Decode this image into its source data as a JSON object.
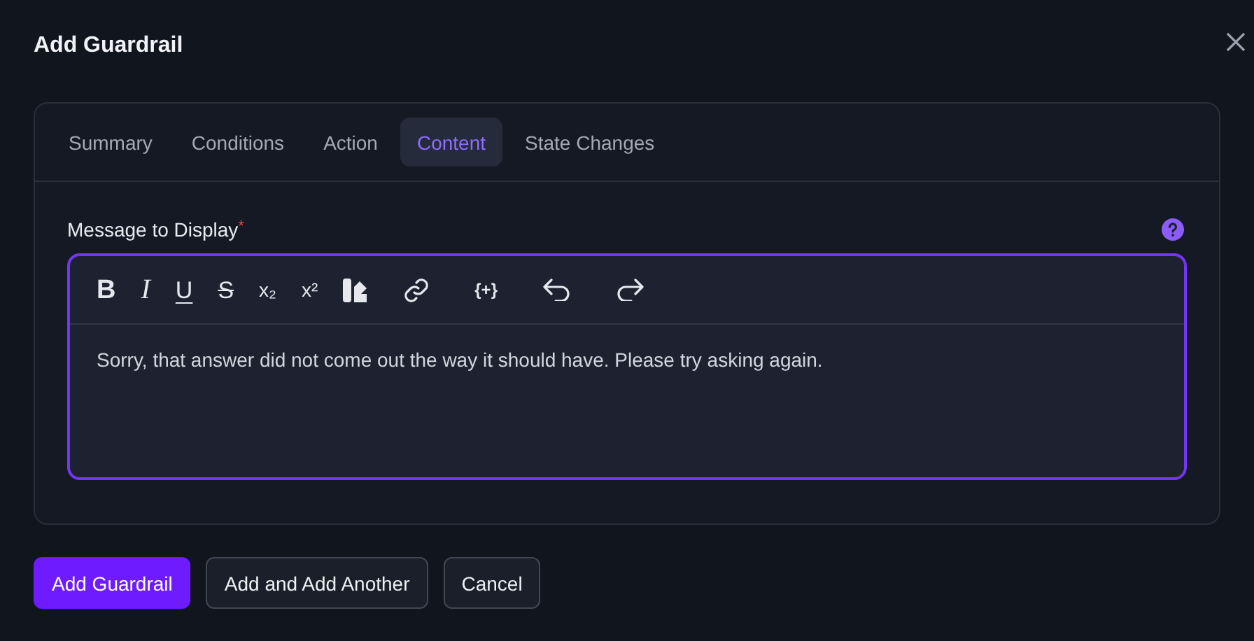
{
  "dialog": {
    "title": "Add Guardrail",
    "tabs": [
      {
        "label": "Summary",
        "selected": false
      },
      {
        "label": "Conditions",
        "selected": false
      },
      {
        "label": "Action",
        "selected": false
      },
      {
        "label": "Content",
        "selected": true
      },
      {
        "label": "State Changes",
        "selected": false
      }
    ],
    "field": {
      "label": "Message to Display",
      "required_mark": "*"
    },
    "toolbar": [
      {
        "kind": "bold",
        "glyph": "B"
      },
      {
        "kind": "italic",
        "glyph": "I"
      },
      {
        "kind": "underline",
        "glyph": "U"
      },
      {
        "kind": "strike",
        "glyph": "S"
      },
      {
        "kind": "subscript",
        "glyph": "x₂"
      },
      {
        "kind": "superscript",
        "glyph": "x²"
      },
      {
        "kind": "highlight"
      },
      {
        "kind": "link"
      },
      {
        "kind": "variable",
        "glyph": "{+}"
      },
      {
        "kind": "undo"
      },
      {
        "kind": "redo"
      }
    ],
    "editor": {
      "value": "Sorry, that answer did not come out the way it should have. Please try asking again."
    },
    "buttons": [
      {
        "label": "Add Guardrail",
        "kind": "primary"
      },
      {
        "label": "Add and Add Another",
        "kind": "secondary"
      },
      {
        "label": "Cancel",
        "kind": "secondary"
      }
    ]
  }
}
